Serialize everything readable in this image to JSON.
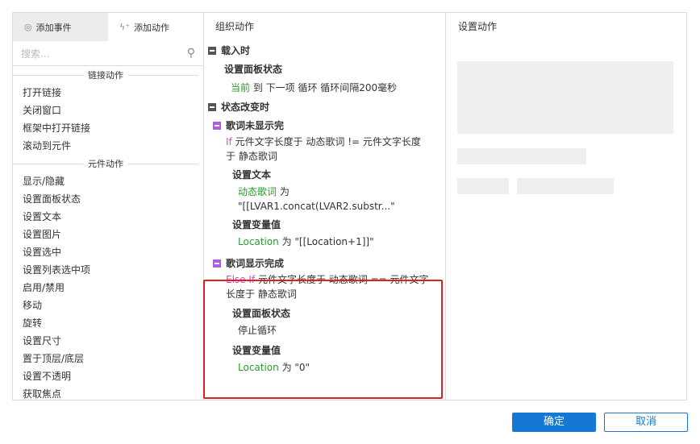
{
  "left": {
    "tabs": [
      {
        "label": "添加事件",
        "icon": "cursor-click-icon"
      },
      {
        "label": "添加动作",
        "icon": "lightning-plus-icon"
      }
    ],
    "search_placeholder": "搜索...",
    "sections": [
      {
        "title": "链接动作",
        "items": [
          "打开链接",
          "关闭窗口",
          "框架中打开链接",
          "滚动到元件"
        ]
      },
      {
        "title": "元件动作",
        "items": [
          "显示/隐藏",
          "设置面板状态",
          "设置文本",
          "设置图片",
          "设置选中",
          "设置列表选中项",
          "启用/禁用",
          "移动",
          "旋转",
          "设置尺寸",
          "置于顶层/底层",
          "设置不透明",
          "获取焦点"
        ]
      }
    ]
  },
  "middle": {
    "title": "组织动作",
    "load": {
      "title": "载入时",
      "action": "设置面板状态",
      "detail_green": "当前",
      "detail": " 到 下一项 循环 循环间隔200毫秒"
    },
    "change": {
      "title": "状态改变时",
      "case1": {
        "title": "歌词未显示完",
        "cond_kw": "If",
        "cond": " 元件文字长度于 动态歌词 != 元件文字长度于 静态歌词",
        "a1": "设置文本",
        "a1_green": "动态歌词",
        "a1_text": " 为",
        "a1_value": "\"[[LVAR1.concat(LVAR2.substr...\"",
        "a2": "设置变量值",
        "a2_green": "Location",
        "a2_text": " 为 \"[[Location+1]]\""
      },
      "case2": {
        "title": "歌词显示完成",
        "cond_kw": "Else If",
        "cond": " 元件文字长度于 动态歌词 == 元件文字长度于 静态歌词",
        "a1": "设置面板状态",
        "a1_text": "停止循环",
        "a2": "设置变量值",
        "a2_green": "Location",
        "a2_text": " 为 \"0\""
      }
    }
  },
  "right": {
    "title": "设置动作"
  },
  "footer": {
    "ok": "确定",
    "cancel": "取消"
  },
  "colors": {
    "accent": "#1478d4",
    "highlight": "#e02020",
    "green": "#2a9a2a"
  }
}
